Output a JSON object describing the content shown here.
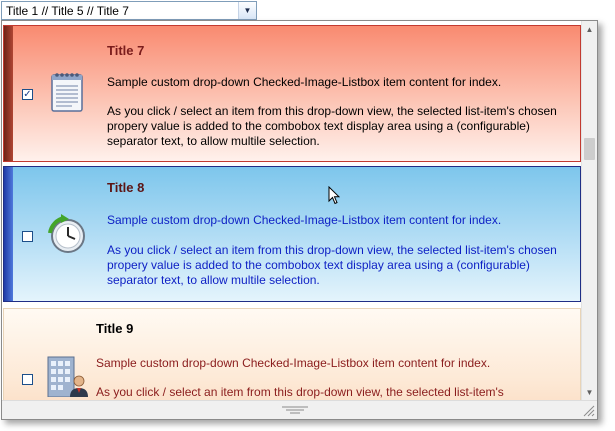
{
  "combo": {
    "text": "Title 1  //  Title 5  //  Title 7",
    "dropdown_glyph": "▼"
  },
  "items": [
    {
      "title": "Title 7",
      "checked": true,
      "check_glyph": "✓",
      "icon": "notepad-icon",
      "summary": "Sample custom drop-down Checked-Image-Listbox item content for index.",
      "description": "As you click / select an item from this drop-down view, the selected list-item's chosen propery value is added to the combobox text display area using a (configurable) separator text, to allow multile selection."
    },
    {
      "title": "Title 8",
      "checked": false,
      "check_glyph": "",
      "icon": "clock-refresh-icon",
      "summary": "Sample custom drop-down Checked-Image-Listbox item content for index.",
      "description": "As you click / select an item from this drop-down view, the selected list-item's chosen propery value is added to the combobox text display area using a (configurable) separator text, to allow multile selection."
    },
    {
      "title": "Title 9",
      "checked": false,
      "check_glyph": "",
      "icon": "office-building-user-icon",
      "summary": "Sample custom drop-down Checked-Image-Listbox item content for index.",
      "description": "As you click / select an item from this drop-down view, the selected list-item's"
    }
  ],
  "scrollbar": {
    "up_glyph": "▲",
    "down_glyph": "▼"
  },
  "colors": {
    "selected_border": "#c23a30",
    "hover_border": "#1f2e86",
    "hover_text": "#0d1fc4"
  }
}
